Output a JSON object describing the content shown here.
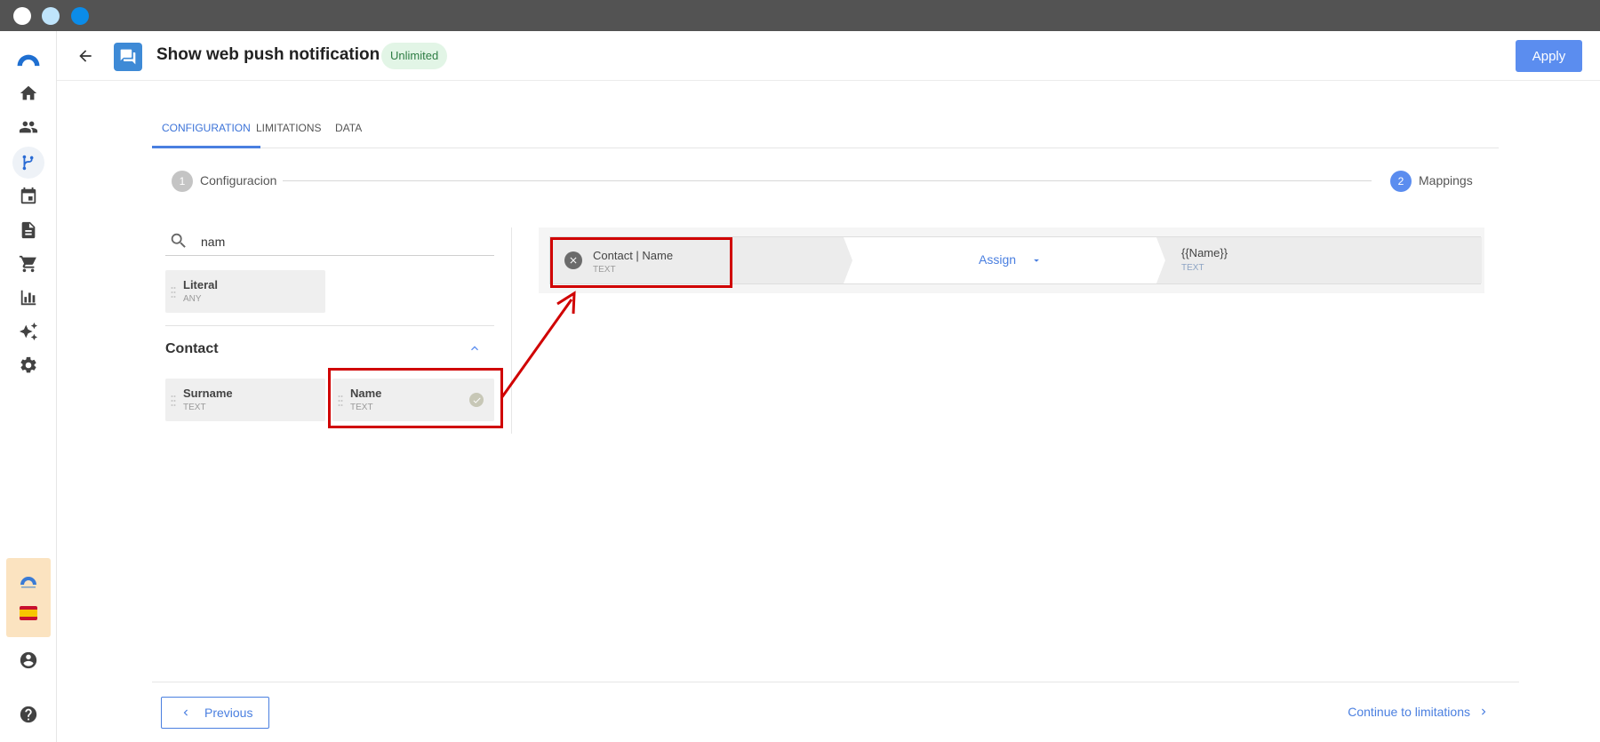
{
  "window": {
    "controls": [
      "close",
      "minimize",
      "maximize"
    ]
  },
  "sidebar": {
    "logo_icon": "arc-logo-icon",
    "items": [
      {
        "icon": "home-icon"
      },
      {
        "icon": "people-icon"
      },
      {
        "icon": "flow-branch-icon",
        "active": true
      },
      {
        "icon": "calendar-icon"
      },
      {
        "icon": "document-icon"
      },
      {
        "icon": "cart-icon"
      },
      {
        "icon": "bar-chart-icon"
      },
      {
        "icon": "sparkle-icon"
      },
      {
        "icon": "gear-icon"
      }
    ],
    "promo_colors": {
      "background": "#fbe3c0"
    },
    "bottom_items": [
      {
        "icon": "account-circle-icon"
      },
      {
        "icon": "help-icon"
      }
    ]
  },
  "header": {
    "title": "Show web push notification",
    "badge": "Unlimited",
    "apply_label": "Apply"
  },
  "tabs": [
    {
      "label": "CONFIGURATION",
      "active": true
    },
    {
      "label": "LIMITATIONS",
      "active": false
    },
    {
      "label": "DATA",
      "active": false
    }
  ],
  "stepper": {
    "steps": [
      {
        "number": "1",
        "label": "Configuracion",
        "state": "done"
      },
      {
        "number": "2",
        "label": "Mappings",
        "state": "active"
      }
    ]
  },
  "fields_panel": {
    "search": {
      "value": "nam",
      "placeholder": ""
    },
    "literal": {
      "name": "Literal",
      "type": "ANY"
    },
    "section": {
      "title": "Contact",
      "expanded": true
    },
    "fields": [
      {
        "name": "Surname",
        "type": "TEXT",
        "mapped": false
      },
      {
        "name": "Name",
        "type": "TEXT",
        "mapped": true
      }
    ]
  },
  "mapping": {
    "source": {
      "name": "Contact | Name",
      "type": "TEXT"
    },
    "operation": "Assign",
    "target": {
      "name": "{{Name}}",
      "type": "TEXT"
    }
  },
  "footer": {
    "previous_label": "Previous",
    "next_label": "Continue to limitations"
  },
  "colors": {
    "accent": "#5b8def",
    "highlight": "#d00000",
    "badge_bg": "#e2f5e6",
    "badge_text": "#2e7d44"
  }
}
